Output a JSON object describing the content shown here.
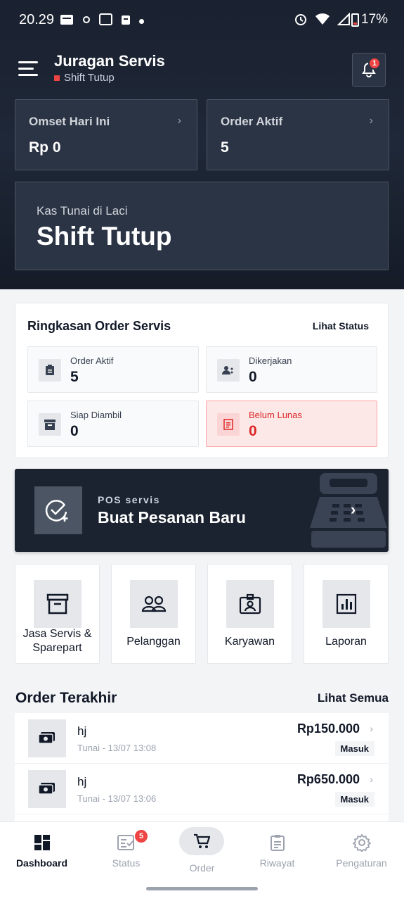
{
  "status_bar": {
    "time": "20.29",
    "battery": "17%"
  },
  "header": {
    "app_title": "Juragan Servis",
    "shift_status": "Shift Tutup",
    "notification_count": "1"
  },
  "stats": [
    {
      "label": "Omset Hari Ini",
      "value": "Rp 0"
    },
    {
      "label": "Order Aktif",
      "value": "5"
    }
  ],
  "cash": {
    "label": "Kas Tunai di Laci",
    "value": "Shift Tutup"
  },
  "summary": {
    "title": "Ringkasan Order Servis",
    "link": "Lihat Status",
    "items": [
      {
        "label": "Order Aktif",
        "value": "5",
        "icon": "clipboard-icon"
      },
      {
        "label": "Dikerjakan",
        "value": "0",
        "icon": "worker-icon"
      },
      {
        "label": "Siap Diambil",
        "value": "0",
        "icon": "archive-icon"
      },
      {
        "label": "Belum Lunas",
        "value": "0",
        "icon": "receipt-icon",
        "alert": true
      }
    ]
  },
  "pos": {
    "subtitle": "POS servis",
    "title": "Buat Pesanan Baru"
  },
  "menu": [
    {
      "label": "Jasa Servis & Sparepart",
      "icon": "archive-icon"
    },
    {
      "label": "Pelanggan",
      "icon": "users-icon"
    },
    {
      "label": "Karyawan",
      "icon": "id-badge-icon"
    },
    {
      "label": "Laporan",
      "icon": "bar-chart-icon"
    }
  ],
  "recent": {
    "title": "Order Terakhir",
    "link": "Lihat Semua",
    "orders": [
      {
        "name": "hj",
        "meta": "Tunai - 13/07 13:08",
        "amount": "Rp150.000",
        "status": "Masuk"
      },
      {
        "name": "hj",
        "meta": "Tunai - 13/07 13:06",
        "amount": "Rp650.000",
        "status": "Masuk"
      }
    ]
  },
  "nav": {
    "items": [
      {
        "label": "Dashboard",
        "icon": "dashboard-icon"
      },
      {
        "label": "Status",
        "icon": "status-icon",
        "badge": "5"
      },
      {
        "label": "Order",
        "icon": "cart-icon"
      },
      {
        "label": "Riwayat",
        "icon": "history-icon"
      },
      {
        "label": "Pengaturan",
        "icon": "gear-icon"
      }
    ],
    "active": "Dashboard"
  },
  "colors": {
    "header_bg": "#1a2130",
    "card_bg": "#2b3444",
    "alert": "#ef4444",
    "page_bg": "#f3f4f6"
  }
}
